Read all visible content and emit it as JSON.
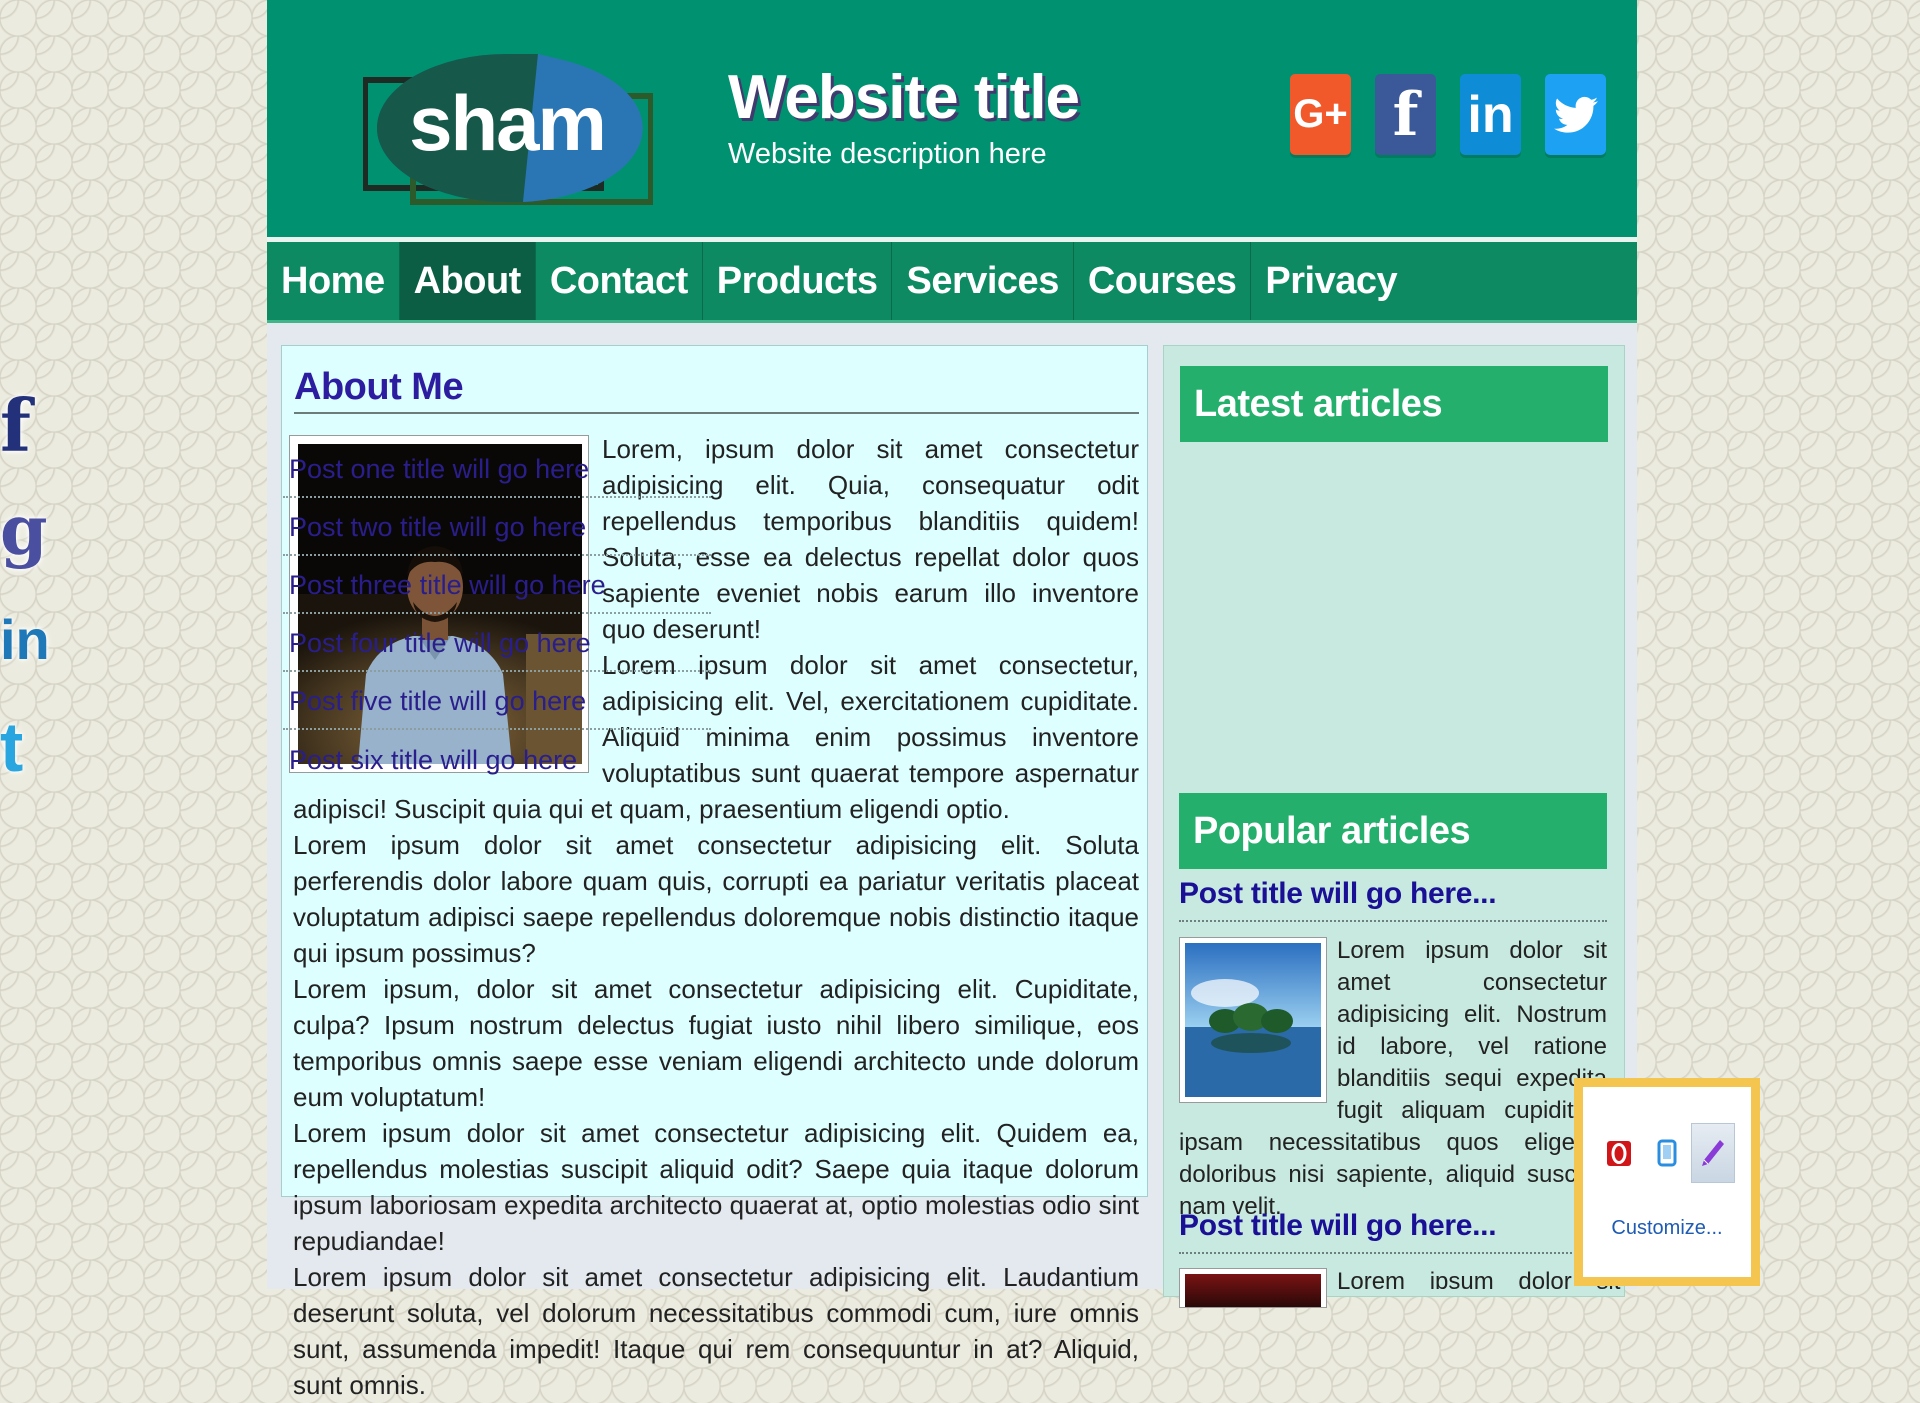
{
  "header": {
    "logo_text": "sham",
    "title": "Website title",
    "description": "Website description here",
    "social": [
      "G+",
      "f",
      "in"
    ]
  },
  "nav": {
    "items": [
      "Home",
      "About",
      "Contact",
      "Products",
      "Services",
      "Courses",
      "Privacy"
    ],
    "active": "About"
  },
  "about": {
    "heading": "About Me",
    "paragraphs": [
      "Lorem, ipsum dolor sit amet consectetur adipisicing elit. Quia, consequatur odit repellendus temporibus blanditiis quidem! Soluta, esse ea delectus repellat dolor quos sapiente eveniet nobis earum illo inventore quo deserunt!",
      "Lorem ipsum dolor sit amet consectetur, adipisicing elit. Vel, exercitationem cupiditate. Aliquid minima enim possimus inventore voluptatibus sunt quaerat tempore aspernatur adipisci! Suscipit quia qui et quam, praesentium eligendi optio.",
      "Lorem ipsum dolor sit amet consectetur adipisicing elit. Soluta perferendis dolor labore quam quis, corrupti ea pariatur veritatis placeat voluptatum adipisci saepe repellendus doloremque nobis distinctio itaque qui ipsum possimus?",
      "Lorem ipsum, dolor sit amet consectetur adipisicing elit. Cupiditate, culpa? Ipsum nostrum delectus fugiat iusto nihil libero similique, eos temporibus omnis saepe esse veniam eligendi architecto unde dolorum eum voluptatum!",
      "Lorem ipsum dolor sit amet consectetur adipisicing elit. Quidem ea, repellendus molestias suscipit aliquid odit? Saepe quia itaque dolorum ipsum laboriosam expedita architecto quaerat at, optio molestias odio sint repudiandae!",
      "Lorem ipsum dolor sit amet consectetur adipisicing elit. Laudantium deserunt soluta, vel dolorum necessitatibus commodi cum, iure omnis sunt, assumenda impedit! Itaque qui rem consequuntur in at? Aliquid, sunt omnis."
    ]
  },
  "sidebar": {
    "latest_heading": "Latest articles",
    "latest": [
      "Post one title will go here",
      "Post two title will go here",
      "Post three title will go here",
      "Post four title will go here",
      "Post five title will go here",
      "Post six title will go here"
    ],
    "popular_heading": "Popular articles",
    "popular": [
      {
        "title": "Post title will go here...",
        "text": "Lorem ipsum dolor sit amet consectetur adipisicing elit. Nostrum id labore, vel ratione blanditiis sequi expedita fugit aliquam cupiditate ipsam necessitatibus quos eligendi doloribus nisi sapiente, aliquid suscipit nam velit."
      },
      {
        "title": "Post title will go here...",
        "text": "Lorem ipsum dolor sit amet"
      }
    ]
  },
  "side_social": [
    "f",
    "g",
    "in",
    "t"
  ],
  "popup": {
    "customize": "Customize..."
  },
  "colors": {
    "header_green": "#009270",
    "nav_green": "#0e8a62",
    "nav_active": "#0b5e43",
    "sidebar_head": "#24b06c",
    "heading_purple": "#2c1ca0",
    "link_blue": "#2a1e8c"
  }
}
